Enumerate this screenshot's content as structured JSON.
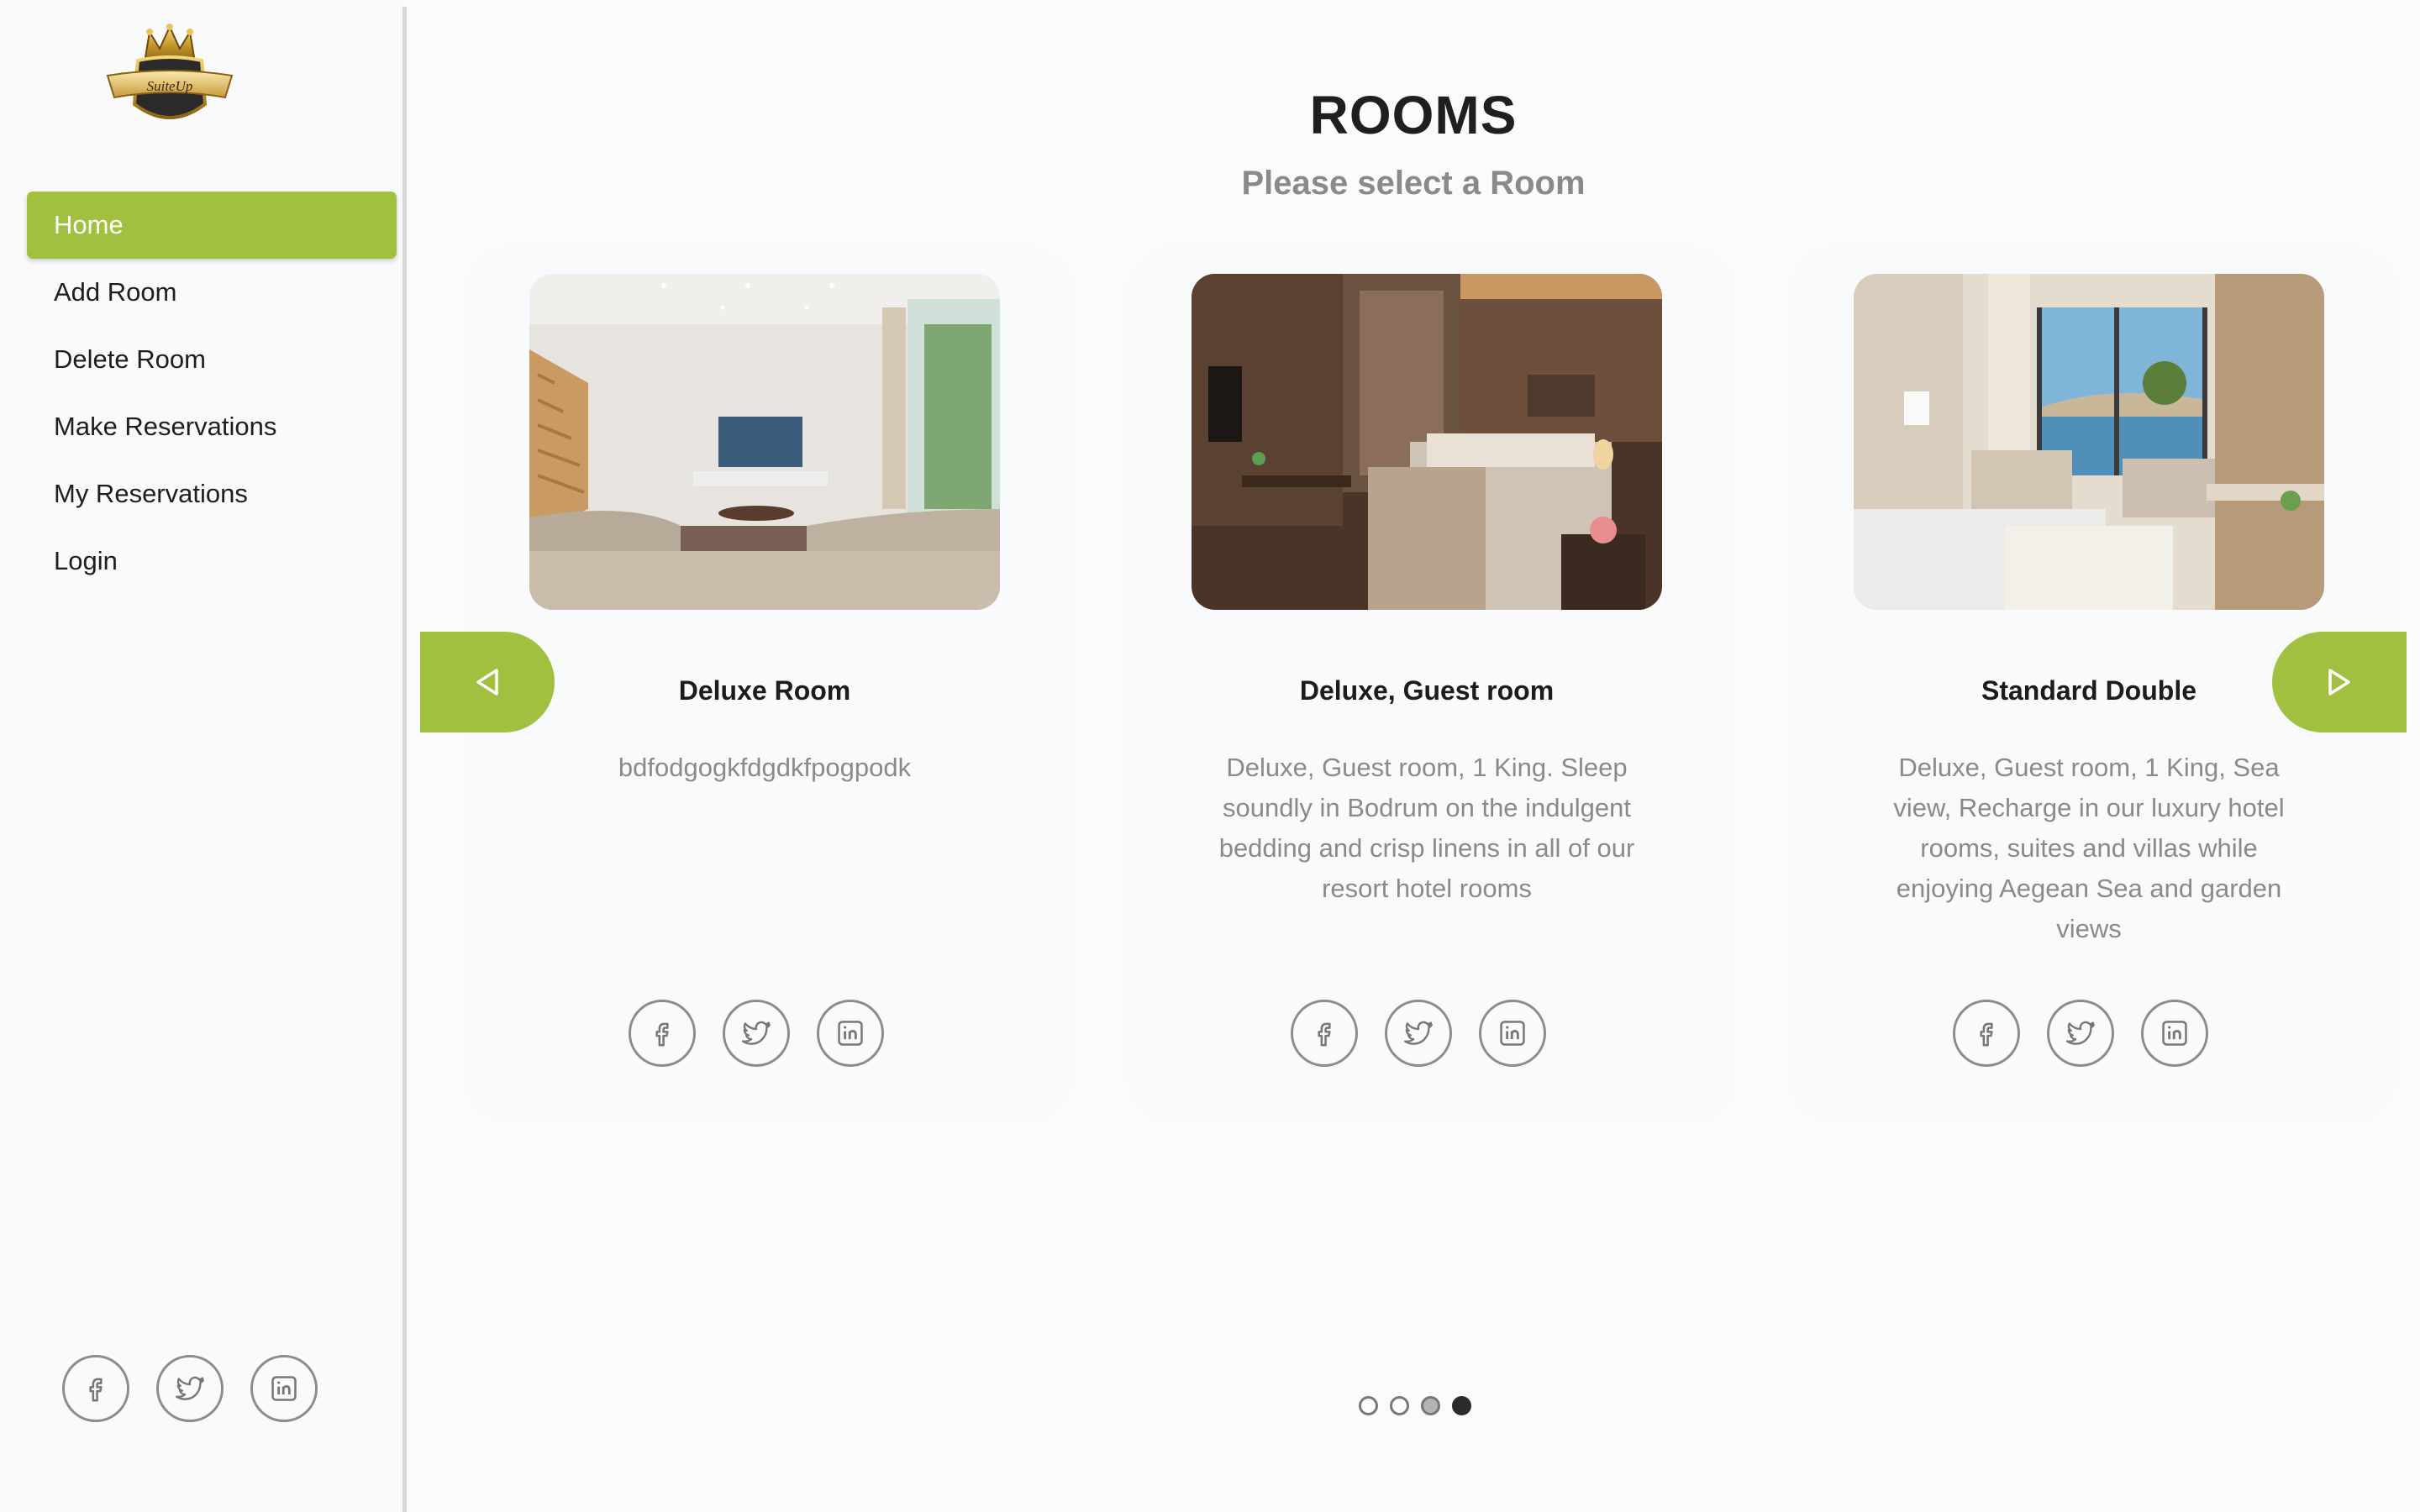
{
  "brand": {
    "logo_text": "SuiteUp"
  },
  "sidebar": {
    "items": [
      {
        "label": "Home",
        "active": true
      },
      {
        "label": "Add Room",
        "active": false
      },
      {
        "label": "Delete Room",
        "active": false
      },
      {
        "label": "Make Reservations",
        "active": false
      },
      {
        "label": "My Reservations",
        "active": false
      },
      {
        "label": "Login",
        "active": false
      }
    ],
    "social": [
      "facebook-icon",
      "twitter-icon",
      "linkedin-icon"
    ]
  },
  "main": {
    "title": "ROOMS",
    "subtitle": "Please select a Room",
    "rooms": [
      {
        "name": "Deluxe Room",
        "description": "bdfodgogkfdgdkfpogpodk"
      },
      {
        "name": "Deluxe, Guest room",
        "description": "Deluxe, Guest room, 1 King. Sleep soundly in Bodrum on the indulgent bedding and crisp linens in all of our resort hotel rooms"
      },
      {
        "name": "Standard Double",
        "description": "Deluxe, Guest room, 1 King, Sea view, Recharge in our luxury hotel rooms, suites and villas while enjoying Aegean Sea and garden views"
      }
    ],
    "carousel": {
      "page_count": 4,
      "active_index": 3
    }
  },
  "colors": {
    "accent": "#a2c03f",
    "text_muted": "#8a8a8a",
    "background": "#fafbfc"
  }
}
